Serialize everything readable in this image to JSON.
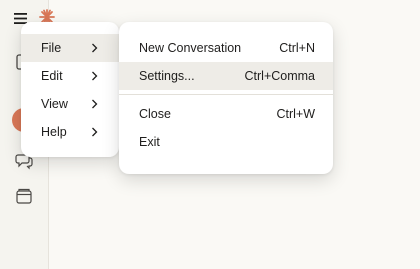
{
  "colors": {
    "accent": "#d97757",
    "background": "#faf9f5",
    "menu_background": "#ffffff",
    "hover": "#eeece7"
  },
  "main_menu": {
    "items": [
      {
        "label": "File",
        "icon": "chevron-right-icon",
        "active": true
      },
      {
        "label": "Edit",
        "icon": "chevron-right-icon",
        "active": false
      },
      {
        "label": "View",
        "icon": "chevron-right-icon",
        "active": false
      },
      {
        "label": "Help",
        "icon": "chevron-right-icon",
        "active": false
      }
    ]
  },
  "file_submenu": {
    "items": [
      {
        "label": "New Conversation",
        "shortcut": "Ctrl+N",
        "highlighted": false
      },
      {
        "label": "Settings...",
        "shortcut": "Ctrl+Comma",
        "highlighted": true
      },
      {
        "label": "Close",
        "shortcut": "Ctrl+W",
        "highlighted": false
      },
      {
        "label": "Exit",
        "shortcut": "",
        "highlighted": false
      }
    ]
  },
  "sidebar": {
    "icons": [
      "menu-icon",
      "logo-icon",
      "sidebar-toggle-icon",
      "avatar-dot",
      "chats-icon",
      "projects-icon"
    ]
  }
}
